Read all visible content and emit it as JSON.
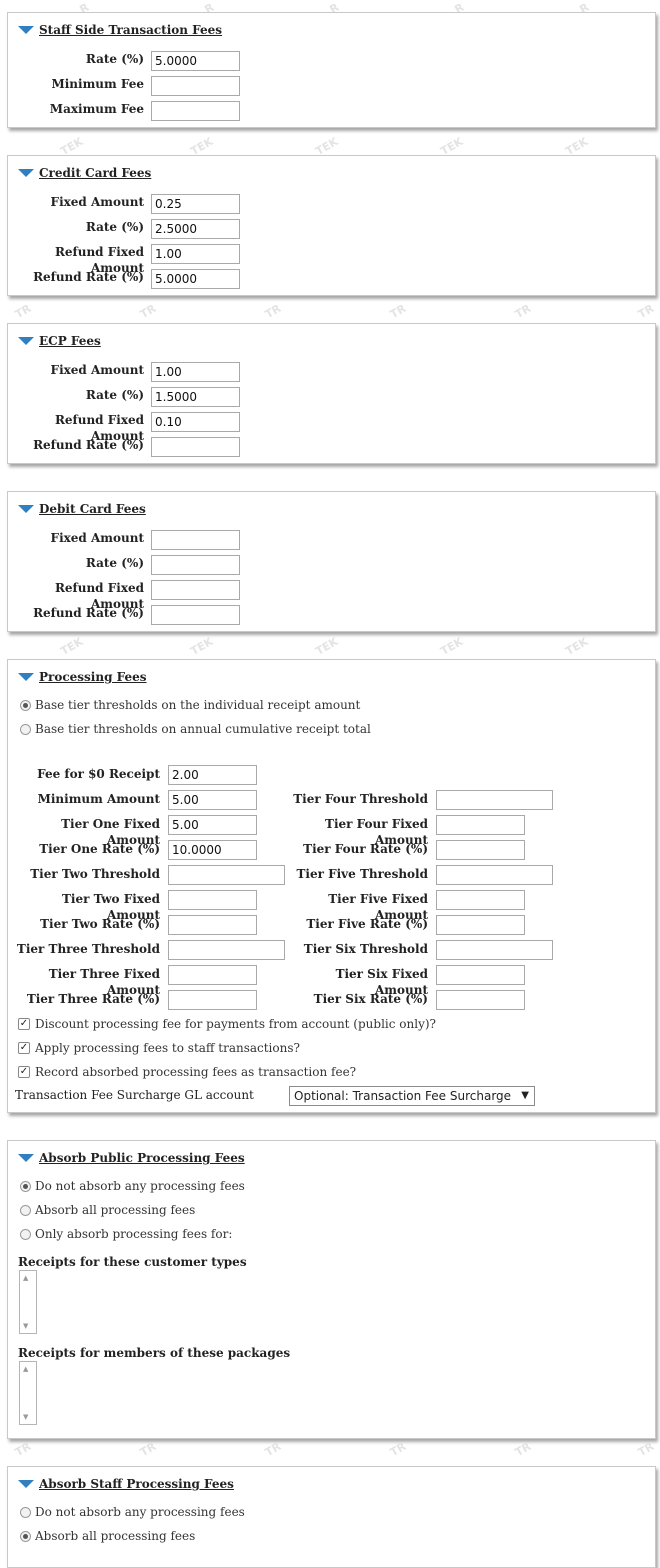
{
  "watermark": {
    "top": "R",
    "mid": "TEK",
    "low": "TR"
  },
  "staff_side": {
    "title": "Staff Side Transaction Fees",
    "rate_label": "Rate (%)",
    "rate_value": "5.0000",
    "min_label": "Minimum Fee",
    "min_value": "",
    "max_label": "Maximum Fee",
    "max_value": ""
  },
  "credit_card": {
    "title": "Credit Card Fees",
    "fixed_label": "Fixed Amount",
    "fixed_value": "0.25",
    "rate_label": "Rate (%)",
    "rate_value": "2.5000",
    "refund_fixed_label": "Refund Fixed Amount",
    "refund_fixed_value": "1.00",
    "refund_rate_label": "Refund Rate (%)",
    "refund_rate_value": "5.0000"
  },
  "ecp": {
    "title": "ECP Fees",
    "fixed_label": "Fixed Amount",
    "fixed_value": "1.00",
    "rate_label": "Rate (%)",
    "rate_value": "1.5000",
    "refund_fixed_label": "Refund Fixed Amount",
    "refund_fixed_value": "0.10",
    "refund_rate_label": "Refund Rate (%)",
    "refund_rate_value": ""
  },
  "debit_card": {
    "title": "Debit Card Fees",
    "fixed_label": "Fixed Amount",
    "fixed_value": "",
    "rate_label": "Rate (%)",
    "rate_value": "",
    "refund_fixed_label": "Refund Fixed Amount",
    "refund_fixed_value": "",
    "refund_rate_label": "Refund Rate (%)",
    "refund_rate_value": ""
  },
  "processing": {
    "title": "Processing Fees",
    "radio_individual": "Base tier thresholds on the individual receipt amount",
    "radio_cumulative": "Base tier thresholds on annual cumulative receipt total",
    "fee_zero_label": "Fee for $0 Receipt",
    "fee_zero_value": "2.00",
    "min_amount_label": "Minimum Amount",
    "min_amount_value": "5.00",
    "t1_fixed_label": "Tier One Fixed Amount",
    "t1_fixed_value": "5.00",
    "t1_rate_label": "Tier One Rate (%)",
    "t1_rate_value": "10.0000",
    "t2_threshold_label": "Tier Two Threshold",
    "t2_threshold_value": "",
    "t2_fixed_label": "Tier Two Fixed Amount",
    "t2_fixed_value": "",
    "t2_rate_label": "Tier Two Rate (%)",
    "t2_rate_value": "",
    "t3_threshold_label": "Tier Three Threshold",
    "t3_threshold_value": "",
    "t3_fixed_label": "Tier Three Fixed Amount",
    "t3_fixed_value": "",
    "t3_rate_label": "Tier Three Rate (%)",
    "t3_rate_value": "",
    "t4_threshold_label": "Tier Four Threshold",
    "t4_threshold_value": "",
    "t4_fixed_label": "Tier Four Fixed Amount",
    "t4_fixed_value": "",
    "t4_rate_label": "Tier Four Rate (%)",
    "t4_rate_value": "",
    "t5_threshold_label": "Tier Five Threshold",
    "t5_threshold_value": "",
    "t5_fixed_label": "Tier Five Fixed Amount",
    "t5_fixed_value": "",
    "t5_rate_label": "Tier Five Rate (%)",
    "t5_rate_value": "",
    "t6_threshold_label": "Tier Six Threshold",
    "t6_threshold_value": "",
    "t6_fixed_label": "Tier Six Fixed Amount",
    "t6_fixed_value": "",
    "t6_rate_label": "Tier Six Rate (%)",
    "t6_rate_value": "",
    "chk_discount": "Discount processing fee for payments from account (public only)?",
    "chk_apply_staff": "Apply processing fees to staff transactions?",
    "chk_record_absorbed": "Record absorbed processing fees as transaction fee?",
    "gl_label": "Transaction Fee Surcharge GL account",
    "gl_selected": "Optional: Transaction Fee Surcharge"
  },
  "absorb_public": {
    "title": "Absorb Public Processing Fees",
    "opt_none": "Do not absorb any processing fees",
    "opt_all": "Absorb all processing fees",
    "opt_only": "Only absorb processing fees for:",
    "customer_types_label": "Receipts for these customer types",
    "packages_label": "Receipts for members of these packages"
  },
  "absorb_staff": {
    "title": "Absorb Staff Processing Fees",
    "opt_none": "Do not absorb any processing fees",
    "opt_all": "Absorb all processing fees"
  },
  "colors": {
    "accent": "#2f7fc1",
    "border": "#c9c9c9"
  }
}
